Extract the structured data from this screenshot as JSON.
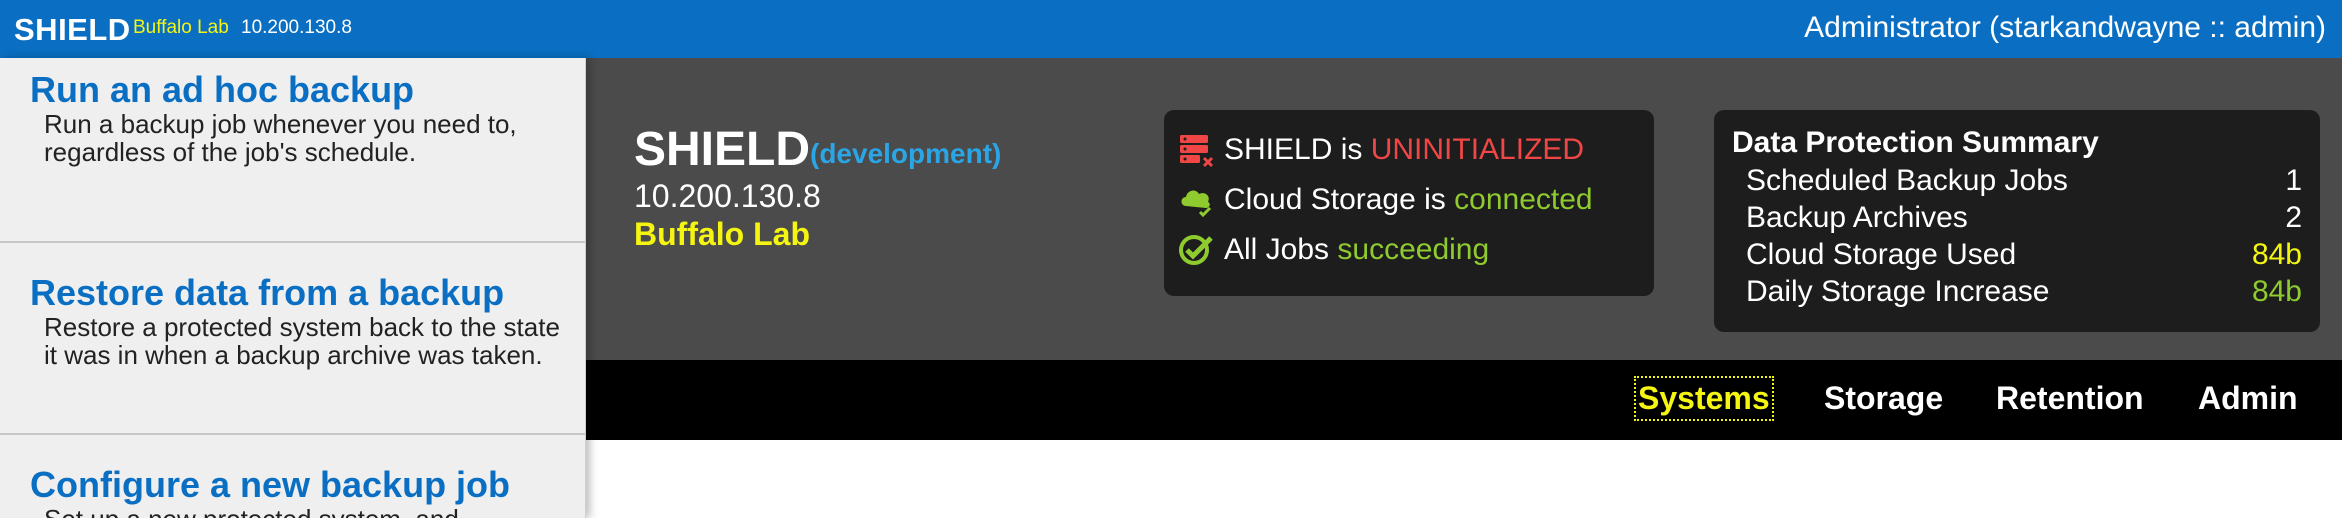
{
  "topbar": {
    "brand": "SHIELD",
    "env": "Buffalo Lab",
    "ip": "10.200.130.8",
    "user": "Administrator (starkandwayne :: admin)"
  },
  "sidebar": {
    "items": [
      {
        "title": "Run an ad hoc backup",
        "desc": "Run a backup job whenever you need to, regardless of the job's schedule."
      },
      {
        "title": "Restore data from a backup",
        "desc": "Restore a protected system back to the state it was in when a backup archive was taken."
      },
      {
        "title": "Configure a new backup job",
        "desc": "Set up a new protected system, and"
      }
    ]
  },
  "hero": {
    "title": "SHIELD",
    "env": "(development)",
    "ip": "10.200.130.8",
    "lab": "Buffalo Lab"
  },
  "status": {
    "rows": [
      {
        "prefix": "SHIELD is ",
        "value": "UNINITIALIZED",
        "icon": "server-error-icon",
        "color": "#f04646"
      },
      {
        "prefix": "Cloud Storage is ",
        "value": "connected",
        "icon": "cloud-check-icon",
        "color": "#8fcb2f"
      },
      {
        "prefix": "All Jobs ",
        "value": "succeeding",
        "icon": "double-check-icon",
        "color": "#8fcb2f"
      }
    ]
  },
  "summary": {
    "title": "Data Protection Summary",
    "rows": [
      {
        "label": "Scheduled Backup Jobs",
        "value": "1"
      },
      {
        "label": "Backup Archives",
        "value": "2"
      },
      {
        "label": "Cloud Storage Used",
        "value": "84b"
      },
      {
        "label": "Daily Storage Increase",
        "value": "84b"
      }
    ]
  },
  "nav": {
    "items": [
      "Systems",
      "Storage",
      "Retention",
      "Admin"
    ],
    "active": "Systems"
  },
  "colors": {
    "brand_blue": "#0a6fc2",
    "accent_yellow": "#f5f512",
    "error_red": "#f04646",
    "ok_green": "#8fcb2f"
  }
}
